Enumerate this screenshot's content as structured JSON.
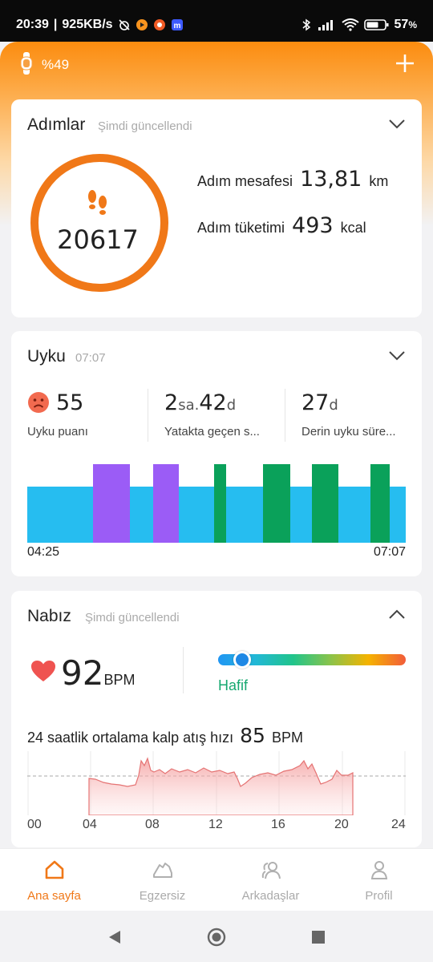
{
  "status_bar": {
    "time": "20:39",
    "speed": "925KB/s",
    "battery": "57"
  },
  "header": {
    "band_battery": "%49"
  },
  "steps": {
    "title": "Adımlar",
    "subtitle": "Şimdi güncellendi",
    "count": "20617",
    "distance_label": "Adım mesafesi",
    "distance_value": "13,81",
    "distance_unit": "km",
    "calories_label": "Adım tüketimi",
    "calories_value": "493",
    "calories_unit": "kcal"
  },
  "sleep": {
    "title": "Uyku",
    "subtitle": "07:07",
    "score_value": "55",
    "score_label": "Uyku puanı",
    "bed_hours": "2",
    "bed_hours_unit": "sa.",
    "bed_minutes": "42",
    "bed_minutes_unit": "d",
    "bed_label": "Yatakta geçen s...",
    "deep_minutes": "27",
    "deep_unit": "d",
    "deep_label": "Derin uyku süre...",
    "start_time": "04:25",
    "end_time": "07:07"
  },
  "heart": {
    "title": "Nabız",
    "subtitle": "Şimdi güncellendi",
    "bpm_value": "92",
    "bpm_unit": "BPM",
    "zone_label": "Hafif",
    "zone_position": 0.13,
    "avg_label": "24 saatlik ortalama kalp atış hızı",
    "avg_value": "85",
    "avg_unit": "BPM",
    "x_ticks": [
      "00",
      "04",
      "08",
      "12",
      "16",
      "20",
      "24"
    ]
  },
  "tabs": [
    {
      "label": "Ana sayfa",
      "icon": "home-icon",
      "active": true
    },
    {
      "label": "Egzersiz",
      "icon": "shoe-icon",
      "active": false
    },
    {
      "label": "Arkadaşlar",
      "icon": "friends-icon",
      "active": false
    },
    {
      "label": "Profil",
      "icon": "profile-icon",
      "active": false
    }
  ],
  "colors": {
    "accent": "#f07818",
    "sleep_light": "#26bdf0",
    "sleep_rem": "#9b5cf6",
    "sleep_deep": "#0aa15a",
    "zone": "#16a870"
  }
}
